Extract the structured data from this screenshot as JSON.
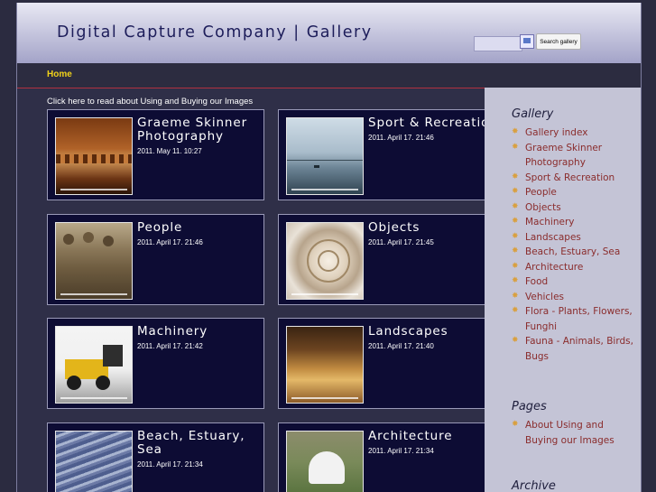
{
  "header": {
    "title": "Digital Capture Company | Gallery",
    "search": {
      "value": "",
      "button_label": "Search gallery"
    }
  },
  "nav": {
    "items": [
      {
        "label": "Home"
      }
    ]
  },
  "intro_link": "Click here to read about Using and Buying our Images",
  "galleries": [
    {
      "title": "Graeme Skinner Photography",
      "date": "2011. May 11. 10:27",
      "thumb_icon": "rusted-machine-photo"
    },
    {
      "title": "Sport & Recreation",
      "date": "2011. April 17. 21:46",
      "thumb_icon": "lake-photo"
    },
    {
      "title": "People",
      "date": "2011. April 17. 21:46",
      "thumb_icon": "soldiers-photo"
    },
    {
      "title": "Objects",
      "date": "2011. April 17. 21:45",
      "thumb_icon": "nautilus-shell-photo"
    },
    {
      "title": "Machinery",
      "date": "2011. April 17. 21:42",
      "thumb_icon": "loader-photo"
    },
    {
      "title": "Landscapes",
      "date": "2011. April 17. 21:40",
      "thumb_icon": "hills-photo"
    },
    {
      "title": "Beach, Estuary, Sea",
      "date": "2011. April 17. 21:34",
      "thumb_icon": "sand-ripples-photo"
    },
    {
      "title": "Architecture",
      "date": "2011. April 17. 21:34",
      "thumb_icon": "marquee-tent-photo"
    }
  ],
  "sidebar": {
    "gallery_heading": "Gallery",
    "gallery_links": [
      "Gallery index",
      "Graeme Skinner Photography",
      "Sport & Recreation",
      "People",
      "Objects",
      "Machinery",
      "Landscapes",
      "Beach, Estuary, Sea",
      "Architecture",
      "Food",
      "Vehicles",
      "Flora - Plants, Flowers, Funghi",
      "Fauna - Animals, Birds, Bugs"
    ],
    "pages_heading": "Pages",
    "pages_links": [
      "About Using and Buying our Images"
    ],
    "archive_heading": "Archive"
  },
  "colors": {
    "nav_home": "#f0d21a",
    "card_bg": "#0d0c34",
    "sidebar_bg": "#c4c4d6",
    "sidebar_link": "#8a2c2c",
    "nav_underline": "#b03040"
  }
}
